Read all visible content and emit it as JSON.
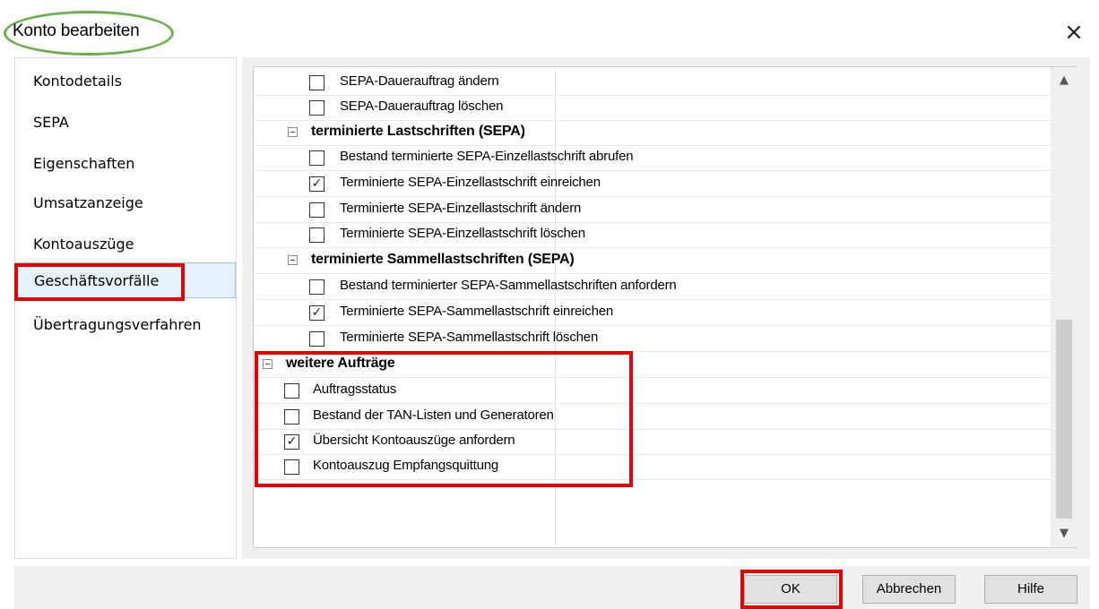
{
  "window": {
    "title": "Konto bearbeiten",
    "close_glyph": "×"
  },
  "nav": {
    "items": [
      {
        "label": "Kontodetails"
      },
      {
        "label": "SEPA"
      },
      {
        "label": "Eigenschaften"
      },
      {
        "label": "Umsatzanzeige"
      },
      {
        "label": "Kontoauszüge"
      },
      {
        "label": "Geschäftsvorfälle",
        "selected": true
      },
      {
        "label": "Übertragungsverfahren"
      }
    ]
  },
  "tree": {
    "rows": [
      {
        "type": "item",
        "label": "SEPA-Dauerauftrag ändern",
        "checked": false
      },
      {
        "type": "item",
        "label": "SEPA-Dauerauftrag löschen",
        "checked": false
      },
      {
        "type": "group",
        "label": "terminierte Lastschriften (SEPA)",
        "expanded": true
      },
      {
        "type": "item",
        "label": "Bestand terminierte SEPA-Einzellastschrift abrufen",
        "checked": false
      },
      {
        "type": "item",
        "label": "Terminierte SEPA-Einzellastschrift einreichen",
        "checked": true
      },
      {
        "type": "item",
        "label": "Terminierte SEPA-Einzellastschrift ändern",
        "checked": false
      },
      {
        "type": "item",
        "label": "Terminierte SEPA-Einzellastschrift löschen",
        "checked": false
      },
      {
        "type": "group",
        "label": "terminierte Sammellastschriften (SEPA)",
        "expanded": true
      },
      {
        "type": "item",
        "label": "Bestand terminierter SEPA-Sammellastschriften anfordern",
        "checked": false
      },
      {
        "type": "item",
        "label": "Terminierte SEPA-Sammellastschrift einreichen",
        "checked": true
      },
      {
        "type": "item",
        "label": "Terminierte SEPA-Sammellastschrift löschen",
        "checked": false
      },
      {
        "type": "group",
        "label": "weitere Aufträge",
        "expanded": true
      },
      {
        "type": "item",
        "label": "Auftragsstatus",
        "checked": false
      },
      {
        "type": "item",
        "label": "Bestand der TAN-Listen und Generatoren",
        "checked": false
      },
      {
        "type": "item",
        "label": "Übersicht Kontoauszüge anfordern",
        "checked": true
      },
      {
        "type": "item",
        "label": "Kontoauszug Empfangsquittung",
        "checked": false
      }
    ]
  },
  "buttons": {
    "ok": "OK",
    "cancel": "Abbrechen",
    "help": "Hilfe"
  },
  "glyphs": {
    "check": "✓",
    "scroll_up": "▲",
    "scroll_down": "▼"
  },
  "colors": {
    "highlight_red": "#e00000",
    "highlight_green": "#6ab04c",
    "selection_bg": "#e5f1fb"
  }
}
